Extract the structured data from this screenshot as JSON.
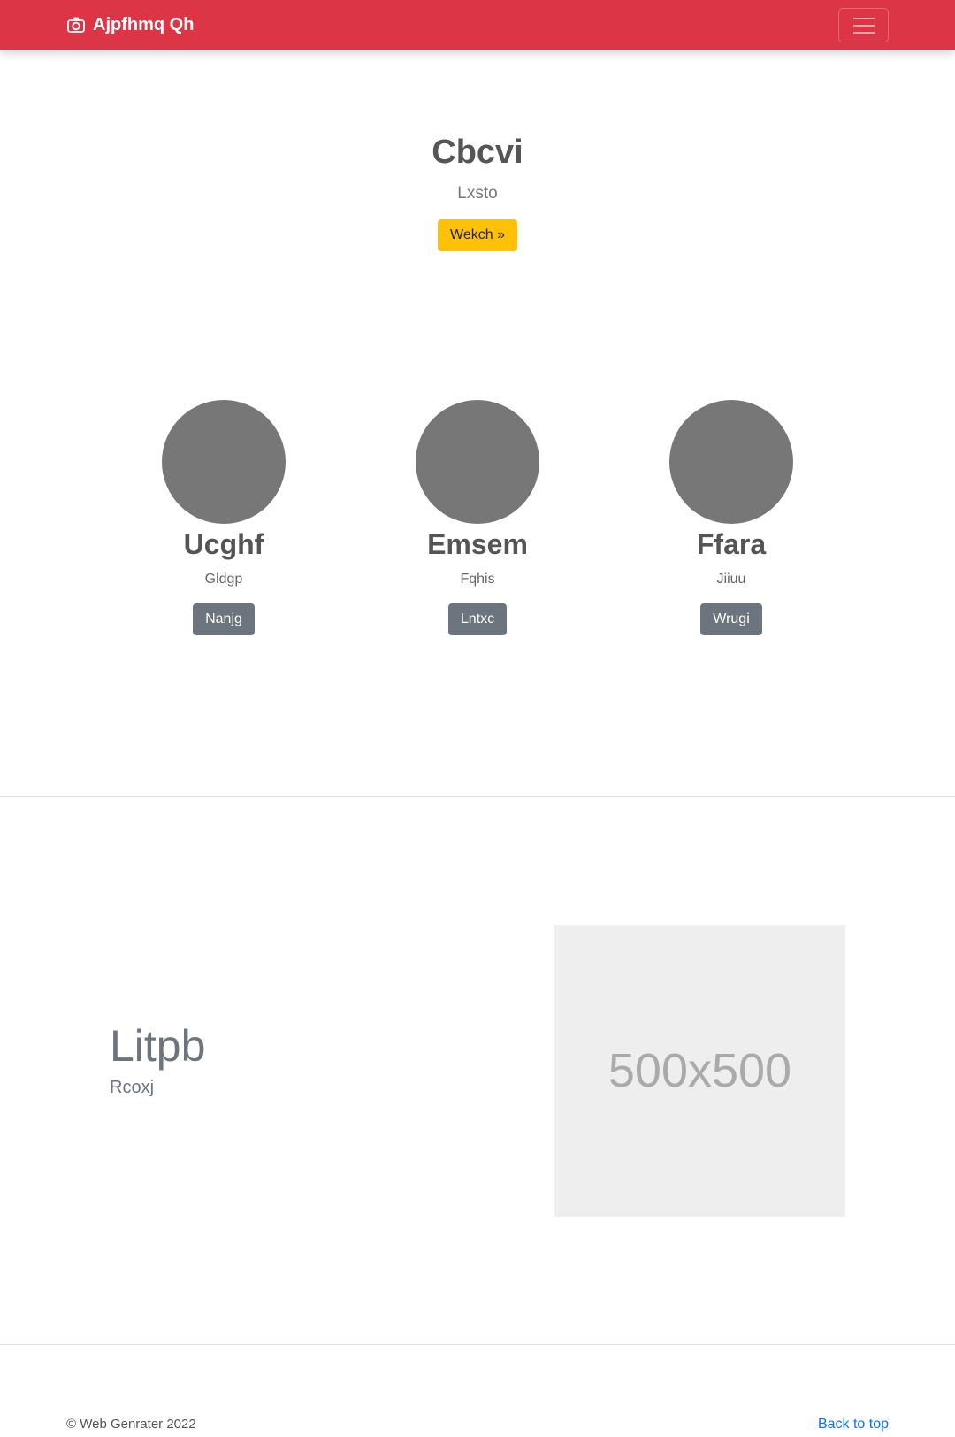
{
  "navbar": {
    "brand": "Ajpfhmq Qh",
    "brand_icon": "camera-icon",
    "toggle_icon": "hamburger-menu-icon",
    "background_color": "#dc3545"
  },
  "hero": {
    "title": "Cbcvi",
    "subtitle": "Lxsto",
    "button_label": "Wekch »",
    "button_color": "#ffc107"
  },
  "features": [
    {
      "title": "Ucghf",
      "text": "Gldgp",
      "button_label": "Nanjg"
    },
    {
      "title": "Emsem",
      "text": "Fqhis",
      "button_label": "Lntxc"
    },
    {
      "title": "Ffara",
      "text": "Jiiuu",
      "button_label": "Wrugi"
    }
  ],
  "showcase": {
    "title": "Litpb",
    "subtitle": "Rcoxj",
    "image_label": "500x500"
  },
  "footer": {
    "copyright": "© Web Genrater 2022",
    "back_to_top": "Back to top",
    "link_color": "#0d6efd"
  }
}
